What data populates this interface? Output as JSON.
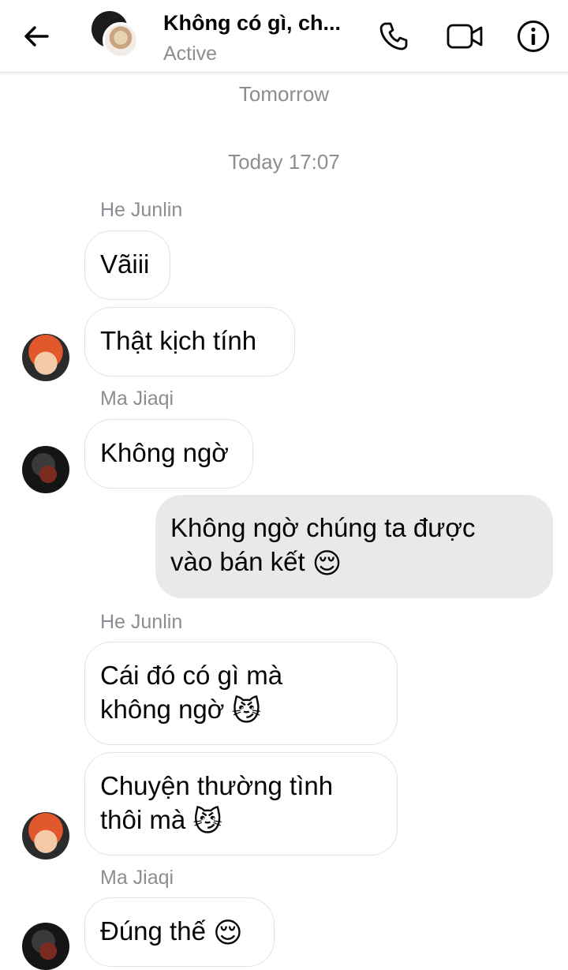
{
  "header": {
    "title": "Không có gì, ch...",
    "status": "Active"
  },
  "separators": [
    "Tomorrow",
    "Today 17:07"
  ],
  "senders": {
    "he_junlin": "He Junlin",
    "ma_jiaqi": "Ma Jiaqi"
  },
  "messages": [
    {
      "sender": "He Junlin",
      "text": "Vãiii"
    },
    {
      "sender": "He Junlin",
      "text": "Thật kịch tính"
    },
    {
      "sender": "Ma Jiaqi",
      "text": "Không ngờ"
    },
    {
      "sender": "me",
      "line1": "Không ngờ chúng ta được",
      "line2": "vào bán kết",
      "emoji": "😌"
    },
    {
      "sender": "He Junlin",
      "line1": "Cái đó có gì mà",
      "line2": "không ngờ",
      "emoji": "😼"
    },
    {
      "sender": "He Junlin",
      "line1": "Chuyện thường tình",
      "line2": "thôi mà",
      "emoji": "😼"
    },
    {
      "sender": "Ma Jiaqi",
      "text": "Đúng thế",
      "emoji": "😌"
    }
  ],
  "icons": {
    "back": "arrow-left-icon",
    "call": "phone-icon",
    "video": "video-camera-icon",
    "info": "info-icon"
  },
  "colors": {
    "own_bubble": "#e9e9e9",
    "other_bubble": "#ffffff",
    "meta_text": "#8a8d91"
  }
}
